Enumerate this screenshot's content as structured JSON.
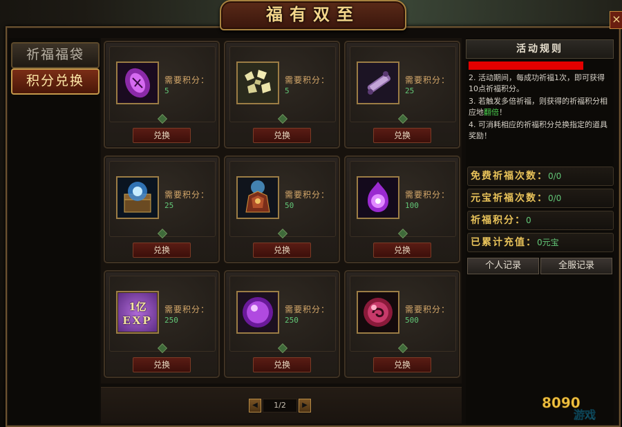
{
  "window": {
    "title": "福有双至",
    "close_label": "×"
  },
  "sidebar": {
    "tabs": [
      {
        "label": "祈福福袋",
        "active": false
      },
      {
        "label": "积分兑换",
        "active": true
      }
    ]
  },
  "items": [
    {
      "icon": "purple-rune-tablet-icon",
      "need_label": "需要积分：",
      "points": "5",
      "button": "兑换"
    },
    {
      "icon": "gold-ore-fragments-icon",
      "need_label": "需要积分：",
      "points": "5",
      "button": "兑换"
    },
    {
      "icon": "purple-scroll-icon",
      "need_label": "需要积分：",
      "points": "25",
      "button": "兑换"
    },
    {
      "icon": "blue-glowing-chest-icon",
      "need_label": "需要积分：",
      "points": "25",
      "button": "兑换"
    },
    {
      "icon": "demon-armor-icon",
      "need_label": "需要积分：",
      "points": "50",
      "button": "兑换"
    },
    {
      "icon": "purple-fire-orb-icon",
      "need_label": "需要积分：",
      "points": "100",
      "button": "兑换"
    },
    {
      "icon": "exp-card-icon",
      "need_label": "需要积分：",
      "points": "250",
      "button": "兑换",
      "icon_text": [
        "1亿",
        "EXP"
      ]
    },
    {
      "icon": "purple-sphere-icon",
      "need_label": "需要积分：",
      "points": "250",
      "button": "兑换"
    },
    {
      "icon": "red-swirl-orb-icon",
      "need_label": "需要积分：",
      "points": "500",
      "button": "兑换"
    }
  ],
  "pager": {
    "prev": "◀",
    "next": "▶",
    "page_text": "1/2"
  },
  "rules": {
    "title": "活动规则",
    "line2": "2. 活动期间，每成功祈福1次，即可获得10点祈福积分。",
    "line3_a": "3. 若触发多倍祈福，则获得的祈福积分相应地",
    "line3_hl": "翻倍",
    "line3_b": "！",
    "line4": "4. 可消耗相应的祈福积分兑换指定的道具奖励！"
  },
  "stats": {
    "free_label": "免费祈福次数：",
    "free_value": "0/0",
    "yuanbao_label": "元宝祈福次数：",
    "yuanbao_value": "0/0",
    "points_label": "祈福积分：",
    "points_value": "0",
    "recharge_label": "已累计充值：",
    "recharge_value": "0元宝"
  },
  "records": {
    "personal": "个人记录",
    "server": "全服记录"
  },
  "colors": {
    "accent_gold": "#e9c35a",
    "value_green": "#63c878",
    "rules_red_bar": "#e40000"
  },
  "watermark": {
    "text": "8090游戏"
  }
}
